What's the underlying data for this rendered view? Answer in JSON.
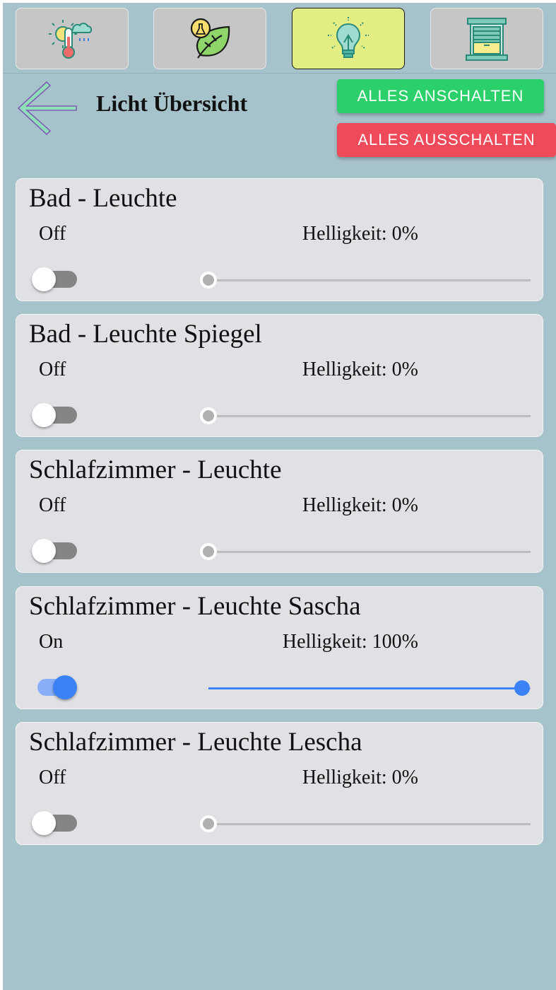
{
  "nav": {
    "tabs": [
      {
        "icon": "climate-thermometer-icon",
        "active": false
      },
      {
        "icon": "plant-leaf-icon",
        "active": false
      },
      {
        "icon": "lightbulb-icon",
        "active": true
      },
      {
        "icon": "window-blind-icon",
        "active": false
      }
    ]
  },
  "header": {
    "back_icon": "arrow-left-icon",
    "title": "Licht Übersicht",
    "all_on_label": "ALLES ANSCHALTEN",
    "all_off_label": "ALLES AUSSCHALTEN"
  },
  "colors": {
    "background": "#a6c2cb",
    "card": "#dfe1e4",
    "active_tab": "#e2ee84",
    "all_on": "#2bd06a",
    "all_off": "#ee4a5a",
    "accent_blue": "#3b82f6"
  },
  "lights": [
    {
      "name": "Bad - Leuchte",
      "state": "Off",
      "on": false,
      "brightness_label": "Helligkeit: 0%",
      "brightness": 0
    },
    {
      "name": "Bad - Leuchte Spiegel",
      "state": "Off",
      "on": false,
      "brightness_label": "Helligkeit: 0%",
      "brightness": 0
    },
    {
      "name": "Schlafzimmer - Leuchte",
      "state": "Off",
      "on": false,
      "brightness_label": "Helligkeit: 0%",
      "brightness": 0
    },
    {
      "name": "Schlafzimmer - Leuchte Sascha",
      "state": "On",
      "on": true,
      "brightness_label": "Helligkeit: 100%",
      "brightness": 100
    },
    {
      "name": "Schlafzimmer - Leuchte Lescha",
      "state": "Off",
      "on": false,
      "brightness_label": "Helligkeit: 0%",
      "brightness": 0
    }
  ]
}
